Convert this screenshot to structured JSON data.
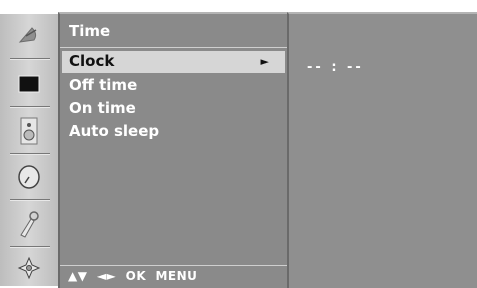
{
  "menu": {
    "title": "Time",
    "items": [
      {
        "label": "Clock",
        "selected": true
      },
      {
        "label": "Off time",
        "selected": false
      },
      {
        "label": "On time",
        "selected": false
      },
      {
        "label": "Auto sleep",
        "selected": false
      }
    ],
    "selected_arrow": "►",
    "footer": "▲▼  ◄►  OK  MENU"
  },
  "value_panel": {
    "clock_value": "-- : --"
  },
  "sidebar": {
    "icons": [
      "satellite-dish-icon",
      "picture-icon",
      "speaker-icon",
      "clock-icon",
      "lock-key-icon",
      "option-cross-icon"
    ]
  },
  "colors": {
    "panel": "#8a8a8a",
    "highlight": "#d6d6d6",
    "text": "#ffffff"
  }
}
